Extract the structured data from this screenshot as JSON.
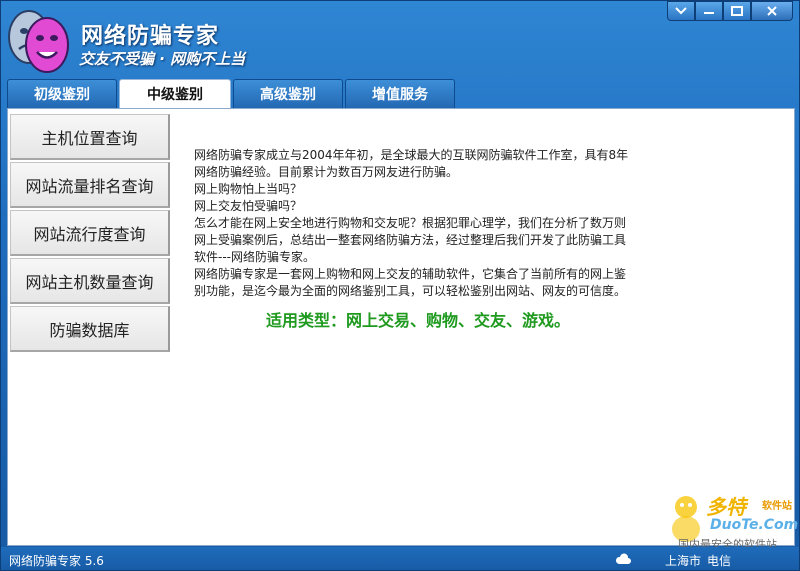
{
  "app": {
    "title": "网络防骗专家",
    "slogan": "交友不受骗 · 网购不上当"
  },
  "window_controls": [
    "menu-icon",
    "minimize-icon",
    "maximize-icon",
    "close-icon"
  ],
  "tabs": [
    {
      "label": "初级鉴别",
      "active": false
    },
    {
      "label": "中级鉴别",
      "active": true
    },
    {
      "label": "高级鉴别",
      "active": false
    },
    {
      "label": "增值服务",
      "active": false
    }
  ],
  "side_menu": [
    {
      "label": "主机位置查询"
    },
    {
      "label": "网站流量排名查询"
    },
    {
      "label": "网站流行度查询"
    },
    {
      "label": "网站主机数量查询"
    },
    {
      "label": "防骗数据库"
    }
  ],
  "description": [
    "网络防骗专家成立与2004年年初，是全球最大的互联网防骗软件工作室，具有8年",
    "网络防骗经验。目前累计为数百万网友进行防骗。",
    "网上购物怕上当吗？",
    "网上交友怕受骗吗？",
    "怎么才能在网上安全地进行购物和交友呢？根据犯罪心理学，我们在分析了数万则",
    "网上受骗案例后，总结出一整套网络防骗方法，经过整理后我们开发了此防骗工具",
    "软件---网络防骗专家。",
    "网络防骗专家是一套网上购物和网上交友的辅助软件，它集合了当前所有的网上鉴",
    "别功能，是迄今最为全面的网络鉴别工具，可以轻松鉴别出网站、网友的可信度。"
  ],
  "usage": "适用类型：网上交易、购物、交友、游戏。",
  "watermark": {
    "brand": "多特",
    "brand_sub": "软件站",
    "domain": "DuoTe.Com",
    "slogan": "国内最安全的软件站"
  },
  "status": {
    "version": "网络防骗专家 5.6",
    "location": "上海市",
    "isp": "电信"
  },
  "colors": {
    "window_blue": "#1e6cbd",
    "usage_green": "#1f9a1f"
  }
}
